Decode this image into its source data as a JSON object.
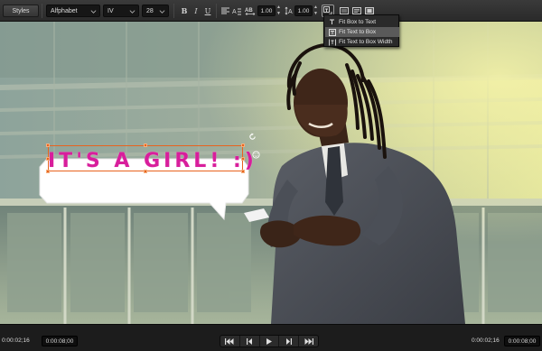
{
  "toolbar": {
    "styles_label": "Styles",
    "font_family": "Alfphabet",
    "font_weight": "IV",
    "font_size": "28",
    "bold_label": "B",
    "italic_label": "I",
    "underline_label": "U",
    "tracking_value": "1.00",
    "leading_value": "1.00"
  },
  "fit_menu": {
    "items": [
      {
        "label": "Fit Box to Text",
        "icon": "fit-box-to-text-icon",
        "selected": false
      },
      {
        "label": "Fit Text to Box",
        "icon": "fit-text-to-box-icon",
        "selected": true
      },
      {
        "label": "Fit Text to Box Width",
        "icon": "fit-text-to-box-width-icon",
        "selected": false
      }
    ]
  },
  "canvas": {
    "caption_text": "IT'S A GIRL! :)",
    "caption_color": "#d81e9c",
    "selection_color": "#e8631e"
  },
  "transport": {
    "start_timecode": "0:00:02;16",
    "start_duration": "0:00:08;00",
    "end_timecode": "0:00:02;16",
    "end_duration": "0:00:08;00",
    "buttons": [
      "skip-to-start-icon",
      "step-back-icon",
      "play-icon",
      "step-forward-icon",
      "skip-to-end-icon"
    ]
  },
  "colors": {
    "toolbar_bg": "#2f2f2f",
    "field_bg": "#161616",
    "menu_selected": "#5a5a5a"
  }
}
